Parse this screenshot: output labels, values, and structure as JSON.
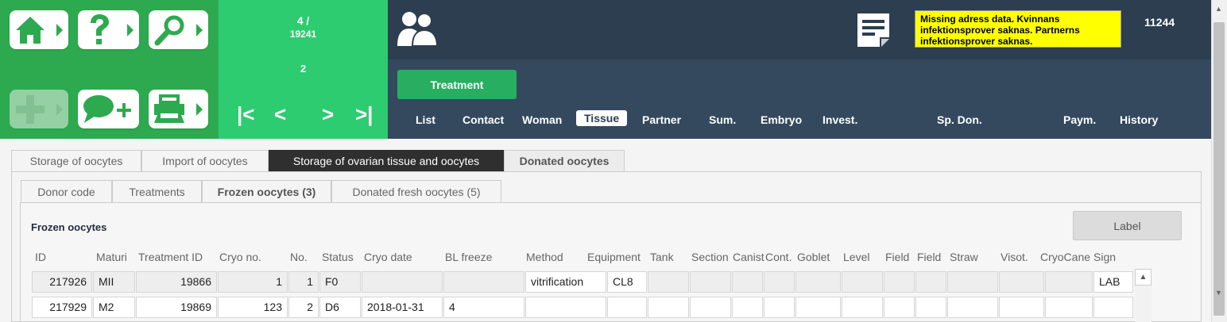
{
  "record_counter": {
    "current": "4 /",
    "total": "19241",
    "sub": "2"
  },
  "icons": {
    "home": "home-icon",
    "help": "question-mark-icon",
    "search": "magnifier-icon",
    "add": "plus-icon",
    "new_message": "chat-bubble-plus-icon",
    "print": "printer-icon",
    "first": "first-page-icon",
    "prev": "previous-icon",
    "next": "next-icon",
    "last": "last-page-icon",
    "people": "people-icon",
    "note": "note-icon"
  },
  "nav_glyphs": {
    "first": "|<",
    "prev": "<",
    "next": ">",
    "last": ">|"
  },
  "warning_text": "Missing adress data. Kvinnans infektionsprover saknas. Partnerns infektionsprover saknas.",
  "user_id": "11244",
  "treatment_button": "Treatment",
  "nav_tabs": [
    "List",
    "Contact",
    "Woman",
    "Tissue",
    "Partner",
    "Sum.",
    "Embryo",
    "Invest.",
    "Sp. Don.",
    "Paym.",
    "History"
  ],
  "primary_tabs": [
    "Storage of oocytes",
    "Import of oocytes",
    "Storage of ovarian tissue and oocytes",
    "Donated oocytes"
  ],
  "secondary_tabs": [
    "Donor code",
    "Treatments",
    "Frozen oocytes (3)",
    "Donated fresh oocytes (5)"
  ],
  "section_title": "Frozen oocytes",
  "label_button": "Label",
  "columns": [
    "ID",
    "Maturi",
    "Treatment ID",
    "Cryo no.",
    "No.",
    "Status",
    "Cryo date",
    "BL freeze",
    "Method",
    "Equipment",
    "Tank",
    "Section",
    "Canist",
    "Cont.",
    "Goblet",
    "Level",
    "Field",
    "Field",
    "Straw",
    "Visot.",
    "CryoCane",
    "Sign"
  ],
  "rows": [
    {
      "id": "217926",
      "maturi": "MII",
      "treatment_id": "19866",
      "cryo_no": "1",
      "no": "1",
      "status": "F0",
      "cryo_date": "",
      "bl_freeze": "",
      "method": "vitrification",
      "equipment": "CL8",
      "tank": "",
      "section": "",
      "canist": "",
      "cont": "",
      "goblet": "",
      "level": "",
      "field1": "",
      "field2": "",
      "straw": "",
      "visot": "",
      "cryocane": "",
      "sign": "LAB"
    },
    {
      "id": "217929",
      "maturi": "M2",
      "treatment_id": "19869",
      "cryo_no": "123",
      "no": "2",
      "status": "D6",
      "cryo_date": "2018-01-31",
      "bl_freeze": "4",
      "method": "",
      "equipment": "",
      "tank": "",
      "section": "",
      "canist": "",
      "cont": "",
      "goblet": "",
      "level": "",
      "field1": "",
      "field2": "",
      "straw": "",
      "visot": "",
      "cryocane": "",
      "sign": ""
    }
  ],
  "colors": {
    "green_dark": "#2daa4f",
    "green_light": "#2ecc71",
    "navy": "#2c3e50",
    "navy_light": "#34495e",
    "warning": "#ffff00"
  }
}
